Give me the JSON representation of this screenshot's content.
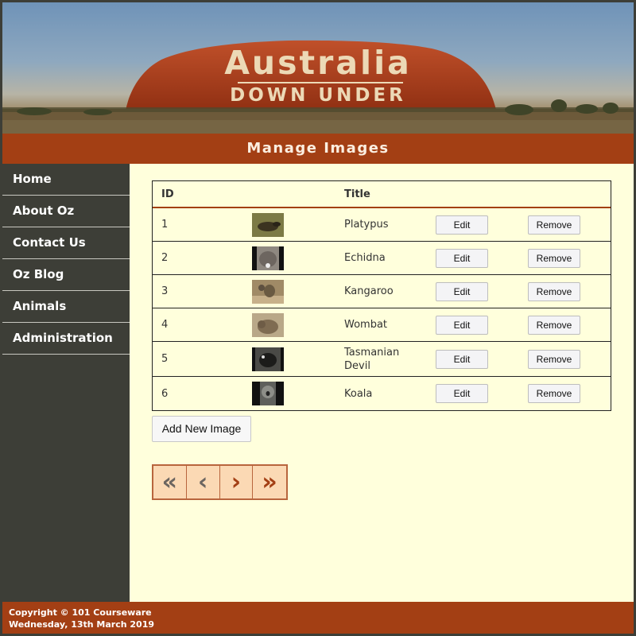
{
  "banner": {
    "title": "Australia",
    "subtitle": "DOWN UNDER"
  },
  "page_heading": "Manage Images",
  "sidebar": {
    "items": [
      {
        "label": "Home"
      },
      {
        "label": "About Oz"
      },
      {
        "label": "Contact Us"
      },
      {
        "label": "Oz Blog"
      },
      {
        "label": "Animals"
      },
      {
        "label": "Administration"
      }
    ]
  },
  "table": {
    "headers": {
      "id": "ID",
      "title": "Title"
    },
    "rows": [
      {
        "id": "1",
        "title": "Platypus",
        "thumb_color": "#6e6a3a"
      },
      {
        "id": "2",
        "title": "Echidna",
        "thumb_color": "#8a8580"
      },
      {
        "id": "3",
        "title": "Kangaroo",
        "thumb_color": "#9a8464"
      },
      {
        "id": "4",
        "title": "Wombat",
        "thumb_color": "#a99274"
      },
      {
        "id": "5",
        "title": "Tasmanian Devil",
        "thumb_color": "#3a3a38"
      },
      {
        "id": "6",
        "title": "Koala",
        "thumb_color": "#5a5a58"
      }
    ],
    "edit_label": "Edit",
    "remove_label": "Remove"
  },
  "add_button_label": "Add New Image",
  "pager": {
    "first": "«",
    "prev": "‹",
    "next": "›",
    "last": "»"
  },
  "footer": {
    "copyright": "Copyright © 101 Courseware",
    "date": "Wednesday, 13th March 2019"
  },
  "colors": {
    "accent": "#a33f14",
    "sidebar": "#3d3e37",
    "content_bg": "#ffffdc",
    "pager_bg": "#fbd9b4"
  }
}
